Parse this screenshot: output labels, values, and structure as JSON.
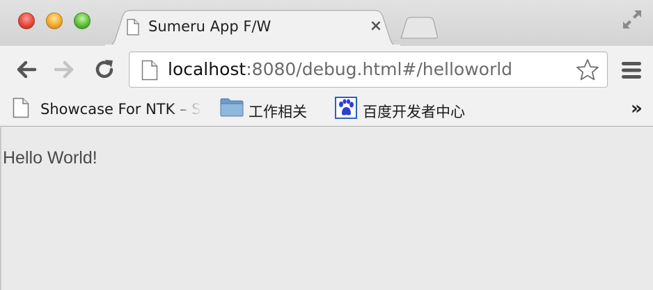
{
  "window": {
    "controls": [
      "close",
      "minimize",
      "zoom"
    ]
  },
  "tab": {
    "title": "Sumeru App F/W",
    "icon": "page-icon",
    "close_glyph": "×"
  },
  "toolbar": {
    "back_icon": "arrow-left-icon",
    "forward_icon": "arrow-right-icon",
    "reload_icon": "reload-icon",
    "menu_icon": "hamburger-menu-icon"
  },
  "omnibox": {
    "host": "localhost",
    "rest": ":8080/debug.html#/helloworld",
    "bookmark_icon": "star-icon"
  },
  "bookmarks": {
    "items": [
      {
        "label": "Showcase For NTK – Sumeru",
        "icon": "page-icon"
      },
      {
        "label": "工作相关",
        "icon": "folder-icon"
      },
      {
        "label": "百度开发者中心",
        "icon": "baidu-paw-icon"
      }
    ],
    "overflow": "»"
  },
  "page": {
    "text": "Hello World!"
  },
  "colors": {
    "tabstrip": "#d8d8d8",
    "toolbar": "#f1f1f1",
    "content_bg": "#eaeaea",
    "url_host": "#111111",
    "url_rest": "#6b6b6b"
  }
}
